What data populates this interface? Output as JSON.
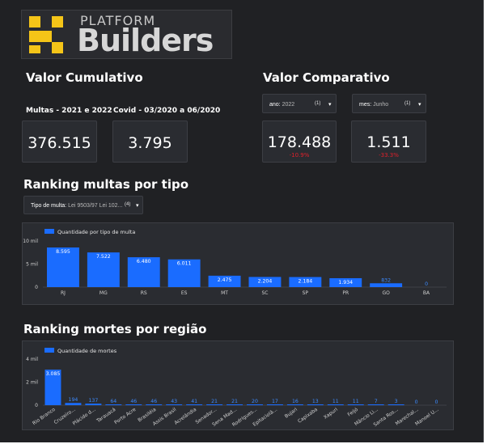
{
  "brand": {
    "top": "PLATFORM",
    "word": "Builders",
    "accent": "#f5c518"
  },
  "cumulative": {
    "title": "Valor Cumulativo",
    "cards": [
      {
        "label": "Multas - 2021 e 2022",
        "value": "376.515"
      },
      {
        "label": "Covid - 03/2020 a 06/2020",
        "value": "3.795"
      }
    ]
  },
  "comparative": {
    "title": "Valor Comparativo",
    "filters": [
      {
        "label": "ano:",
        "selected": "2022",
        "count": "(1)"
      },
      {
        "label": "mes:",
        "selected": "Junho",
        "count": "(1)"
      }
    ],
    "cards": [
      {
        "value": "178.488",
        "delta": "-10.9%"
      },
      {
        "value": "1.511",
        "delta": "-33.3%"
      }
    ]
  },
  "fines_section": {
    "title": "Ranking multas por tipo",
    "filter": {
      "label": "Tipo de multa:",
      "selected": "Lei 9503/97 Lei 102...",
      "count": "(4)"
    }
  },
  "deaths_section": {
    "title": "Ranking mortes por região"
  },
  "colors": {
    "bar": "#1a6cff",
    "background": "#202124",
    "card": "#2a2c31",
    "negative": "#e0202b"
  },
  "chart_data": [
    {
      "type": "bar",
      "legend": "Quantidade por tipo de multa",
      "categories": [
        "RJ",
        "MG",
        "RS",
        "ES",
        "MT",
        "SC",
        "SP",
        "PR",
        "GO",
        "BA"
      ],
      "values": [
        8595,
        7522,
        6480,
        6011,
        2475,
        2204,
        2184,
        1934,
        832,
        0
      ],
      "labels": [
        "8.595",
        "7.522",
        "6.480",
        "6.011",
        "2.475",
        "2.204",
        "2.184",
        "1.934",
        "832",
        "0"
      ],
      "yticks": [
        "0",
        "5 mil",
        "10 mil"
      ],
      "ylim": [
        0,
        10000
      ]
    },
    {
      "type": "bar",
      "legend": "Quantidade de mortes",
      "categories": [
        "Rio Branco",
        "Cruzeiro...",
        "Plácido d...",
        "Tarauacá",
        "Porto Acre",
        "Brasiléia",
        "Assis Brasil",
        "Acrelândia",
        "Senador...",
        "Sena Mad...",
        "Rodrigues...",
        "Epitaciolâ...",
        "Bujari",
        "Capixaba",
        "Xapuri",
        "Feijó",
        "Mâncio Li...",
        "Santa Ros...",
        "Marechal...",
        "Manoel U..."
      ],
      "values": [
        3085,
        194,
        137,
        64,
        46,
        46,
        43,
        41,
        21,
        21,
        20,
        17,
        16,
        13,
        11,
        11,
        7,
        3,
        0,
        0
      ],
      "labels": [
        "3.085",
        "194",
        "137",
        "64",
        "46",
        "46",
        "43",
        "41",
        "21",
        "21",
        "20",
        "17",
        "16",
        "13",
        "11",
        "11",
        "7",
        "3",
        "0",
        "0"
      ],
      "yticks": [
        "0",
        "2 mil",
        "4 mil"
      ],
      "ylim": [
        0,
        4000
      ]
    }
  ]
}
